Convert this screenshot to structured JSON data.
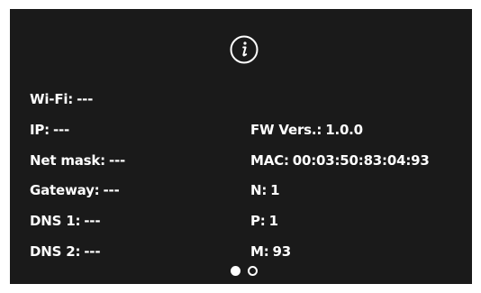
{
  "screen": {
    "icon": "info-icon",
    "left_fields": [
      {
        "label": "Wi-Fi:",
        "value": "---"
      },
      {
        "label": "IP:",
        "value": "---"
      },
      {
        "label": "Net mask:",
        "value": "---"
      },
      {
        "label": "Gateway:",
        "value": "---"
      },
      {
        "label": "DNS 1:",
        "value": "---"
      },
      {
        "label": "DNS 2:",
        "value": "---"
      }
    ],
    "right_fields": [
      {
        "label": "FW Vers.:",
        "value": "1.0.0"
      },
      {
        "label": "MAC:",
        "value": "00:03:50:83:04:93"
      },
      {
        "label": "N:",
        "value": "1"
      },
      {
        "label": "P:",
        "value": "1"
      },
      {
        "label": "M:",
        "value": "93"
      }
    ]
  },
  "pagination": {
    "total_pages": 2,
    "current_page": 1
  },
  "colors": {
    "background": "#1a1a1a",
    "text": "#ffffff"
  }
}
